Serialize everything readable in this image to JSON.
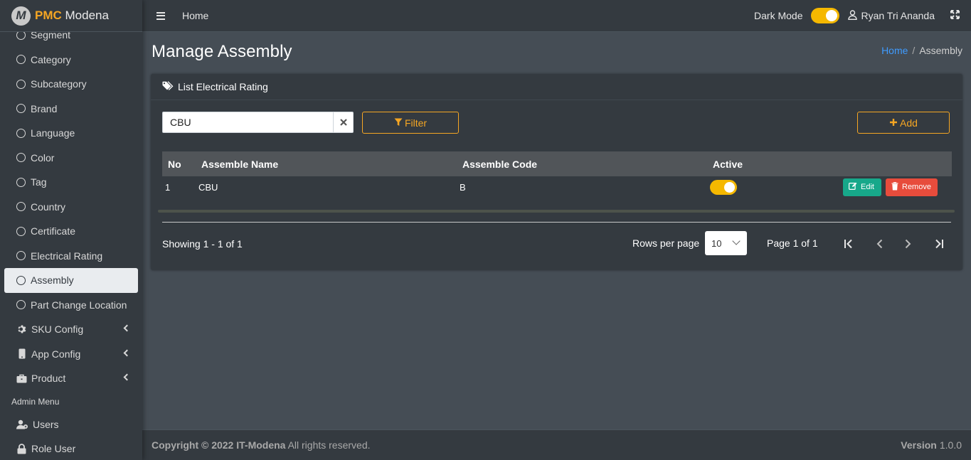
{
  "brand": {
    "logo_letter": "M",
    "name_bold": "PMC",
    "name_rest": " Modena"
  },
  "sidebar": {
    "items": [
      {
        "label": "Segment"
      },
      {
        "label": "Category"
      },
      {
        "label": "Subcategory"
      },
      {
        "label": "Brand"
      },
      {
        "label": "Language"
      },
      {
        "label": "Color"
      },
      {
        "label": "Tag"
      },
      {
        "label": "Country"
      },
      {
        "label": "Certificate"
      },
      {
        "label": "Electrical Rating"
      },
      {
        "label": "Assembly",
        "active": true
      },
      {
        "label": "Part Change Location"
      },
      {
        "label": "SKU Config",
        "icon": "gear-icon"
      },
      {
        "label": "App Config",
        "icon": "mobile-icon"
      },
      {
        "label": "Product",
        "icon": "briefcase-icon"
      }
    ],
    "admin_header": "Admin Menu",
    "admin_items": [
      {
        "label": "Users",
        "icon": "users-icon"
      },
      {
        "label": "Role User",
        "icon": "lock-icon"
      }
    ]
  },
  "topbar": {
    "home_link": "Home",
    "dark_mode_label": "Dark Mode",
    "dark_mode_on": true,
    "user_name": "Ryan Tri Ananda"
  },
  "page": {
    "title": "Manage Assembly",
    "breadcrumb": {
      "home": "Home",
      "sep": "/",
      "current": "Assembly"
    }
  },
  "card": {
    "title": "List Electrical Rating",
    "search_value": "CBU",
    "filter_label": "Filter",
    "add_label": "Add"
  },
  "table": {
    "headers": {
      "no": "No",
      "name": "Assemble Name",
      "code": "Assemble Code",
      "active": "Active"
    },
    "rows": [
      {
        "no": "1",
        "name": "CBU",
        "code": "B",
        "active": true,
        "edit_label": "Edit",
        "remove_label": "Remove"
      }
    ]
  },
  "pagination": {
    "showing": "Showing 1 - 1 of 1",
    "rows_per_page_label": "Rows per page",
    "rows_per_page_value": "10",
    "page_info": "Page 1 of 1"
  },
  "footer": {
    "copyright_bold": "Copyright © 2022 IT-Modena",
    "copyright_rest": " All rights reserved.",
    "version_label": "Version",
    "version_value": "1.0.0"
  },
  "colors": {
    "accent": "#f5a623",
    "toggle": "#f5b800",
    "edit": "#17a88a",
    "remove": "#e74c3c",
    "link": "#3f9bff"
  }
}
